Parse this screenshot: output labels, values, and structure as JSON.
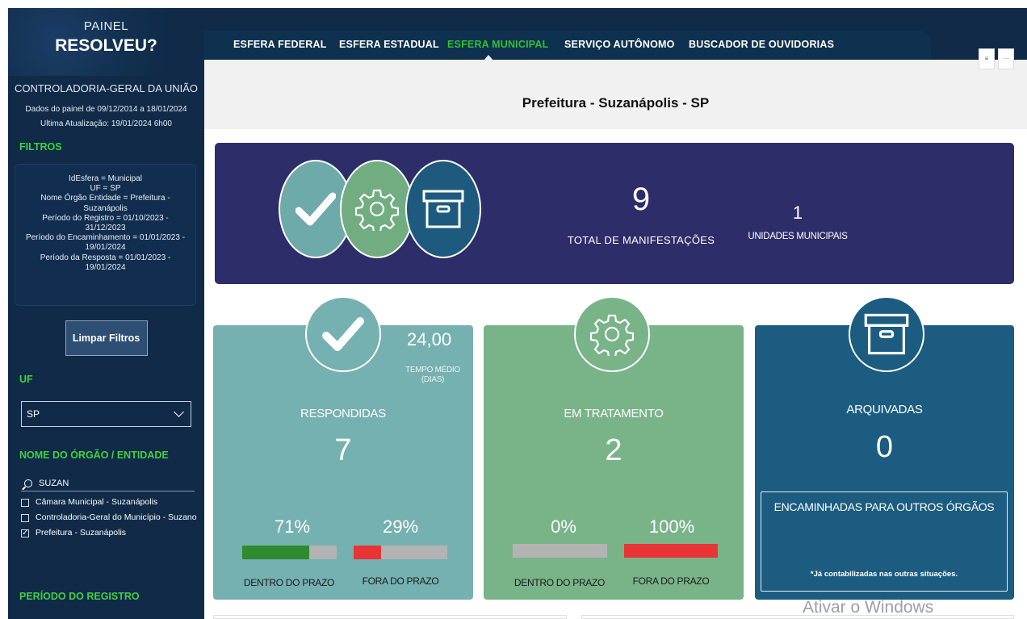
{
  "sidebar": {
    "painel": "PAINEL",
    "resolveu": "RESOLVEU?",
    "cgu": "CONTROLADORIA-GERAL DA UNIÃO",
    "dates_line1": "Dados do painel de 09/12/2014 a 18/01/2024",
    "dates_line2": "Ultima Atualização: 19/01/2024 6h00",
    "filtros_title": "FILTROS",
    "filters": [
      "IdEsfera = Municipal",
      "UF = SP",
      "Nome Órgão Entidade = Prefeitura -",
      "Suzanápolis",
      "Período do Registro = 01/10/2023 -",
      "31/12/2023",
      "Período do Encaminhamento = 01/01/2023 -",
      "19/01/2024",
      "Período da Resposta = 01/01/2023 -",
      "19/01/2024"
    ],
    "clear_button": "Limpar Filtros",
    "uf_title": "UF",
    "uf_value": "SP",
    "orgao_title": "NOME DO ÓRGÃO / ENTIDADE",
    "search_value": "SUZAN",
    "orgaos": [
      {
        "label": "Câmara Municipal - Suzanápolis",
        "checked": false
      },
      {
        "label": "Controladoria-Geral do Município - Suzano",
        "checked": false
      },
      {
        "label": "Prefeitura - Suzanápolis",
        "checked": true
      }
    ],
    "periodo_title": "PERÍODO DO REGISTRO"
  },
  "nav": {
    "tabs": [
      "ESFERA FEDERAL",
      "ESFERA ESTADUAL",
      "ESFERA MUNICIPAL",
      "SERVIÇO AUTÔNOMO",
      "BUSCADOR DE OUVIDORIAS"
    ],
    "active": "ESFERA MUNICIPAL"
  },
  "main": {
    "title": "Prefeitura - Suzanápolis - SP",
    "total_value": "9",
    "total_label": "TOTAL DE MANIFESTAÇÕES",
    "unidades_value": "1",
    "unidades_label": "UNIDADES MUNICIPAIS",
    "respondidas": {
      "label": "RESPONDIDAS",
      "value": "7",
      "tempo_value": "24,00",
      "tempo_label1": "TEMPO MÉDIO",
      "tempo_label2": "(DIAS)",
      "dentro_pct": "71%",
      "fora_pct": "29%",
      "dentro_fill": 0.71,
      "fora_fill": 0.29,
      "dentro_label": "DENTRO DO PRAZO",
      "fora_label": "FORA DO PRAZO"
    },
    "tratamento": {
      "label": "EM TRATAMENTO",
      "value": "2",
      "dentro_pct": "0%",
      "fora_pct": "100%",
      "dentro_fill": 0.0,
      "fora_fill": 1.0,
      "dentro_label": "DENTRO DO PRAZO",
      "fora_label": "FORA DO PRAZO"
    },
    "arquivadas": {
      "label": "ARQUIVADAS",
      "value": "0",
      "encaminhadas_label": "ENCAMINHADAS PARA OUTROS ÓRGÃOS",
      "note": "*Já contabilizadas nas outras situações."
    }
  },
  "watermark": "Ativar o Windows",
  "colors": {
    "accent_green": "#2fc12f",
    "navy": "#102a48",
    "banner": "#2d2d69",
    "teal": "#75b1b0",
    "green": "#79b489",
    "blue": "#1c5c80",
    "ok": "#2e8b2e",
    "late": "#e83434"
  }
}
